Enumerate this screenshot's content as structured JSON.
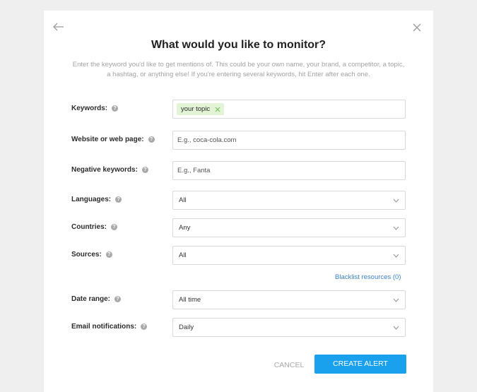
{
  "title": "What would you like to monitor?",
  "subtitle": "Enter the keyword you'd like to get mentions of. This could be your own name, your brand, a competitor, a topic, a hashtag, or anything else! If you're entering several keywords, hit Enter after each one.",
  "help_glyph": "?",
  "fields": {
    "keywords": {
      "label": "Keywords:",
      "tag": "your topic"
    },
    "website": {
      "label": "Website or web page:",
      "placeholder": "E.g., coca-cola.com"
    },
    "negative": {
      "label": "Negative keywords:",
      "placeholder": "E.g., Fanta"
    },
    "languages": {
      "label": "Languages:",
      "value": "All"
    },
    "countries": {
      "label": "Countries:",
      "value": "Any"
    },
    "sources": {
      "label": "Sources:",
      "value": "All"
    },
    "date_range": {
      "label": "Date range:",
      "value": "All time"
    },
    "email": {
      "label": "Email notifications:",
      "value": "Daily"
    }
  },
  "blacklist_link": "Blacklist resources (0)",
  "buttons": {
    "cancel": "CANCEL",
    "create": "CREATE ALERT"
  },
  "colors": {
    "accent": "#1aa1ee",
    "link": "#3b84c9",
    "tag_bg": "#e3f3d6",
    "tag_x": "#7bbf5a"
  }
}
